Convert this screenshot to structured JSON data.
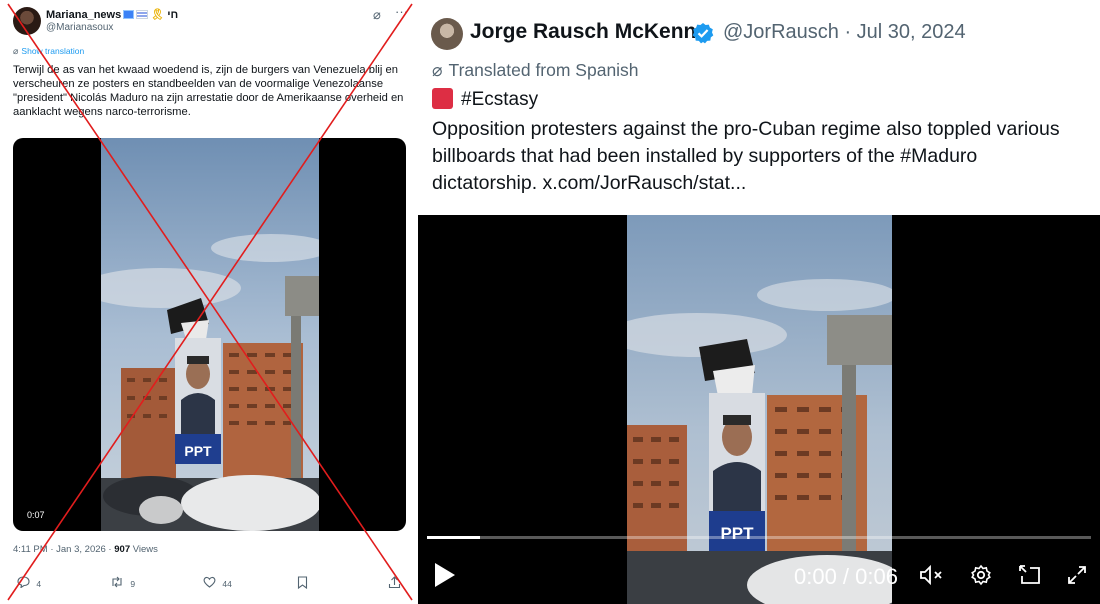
{
  "left_tweet": {
    "author": {
      "name": "Mariana_news",
      "name_suffix": "חי",
      "handle": "@Marianasoux"
    },
    "grok_icon": "grok-icon",
    "more_icon": "more-icon",
    "show_translation": "Show translation",
    "text": "Terwijl de as van het kwaad woedend is, zijn de burgers van Venezuela blij en verscheuren ze posters en standbeelden van de voormalige Venezolaanse \"president\" Nicolás Maduro na zijn arrestatie door de Amerikaanse overheid en aanklacht wegens narco-terrorisme.",
    "video": {
      "duration": "0:07",
      "banner_text": "PPT"
    },
    "meta": {
      "time": "4:11 PM",
      "separator1": " · ",
      "date": "Jan 3, 2026",
      "separator2": " · ",
      "views": "907",
      "views_label": " Views"
    },
    "actions": {
      "replies": "4",
      "reposts": "9",
      "likes": "44"
    },
    "crossed_out_color": "#e11d1d"
  },
  "right_tweet": {
    "author": {
      "name": "Jorge Rausch McKenna",
      "handle": "@JorRausch · Jul 30, 2024",
      "verified_color": "#1d9bf0"
    },
    "translated_label": "Translated from Spanish",
    "hashtag_line": "#Ecstasy",
    "text": "Opposition protesters against the pro-Cuban regime also toppled various billboards that had been installed by supporters of the #Maduro dictatorship. x.com/JorRausch/stat...",
    "video": {
      "timer": "0:00 / 0:06",
      "progress": 0.08,
      "banner_text": "PPT",
      "controls": [
        "mute-icon",
        "settings-icon",
        "picture-in-picture-icon",
        "fullscreen-icon"
      ]
    }
  }
}
